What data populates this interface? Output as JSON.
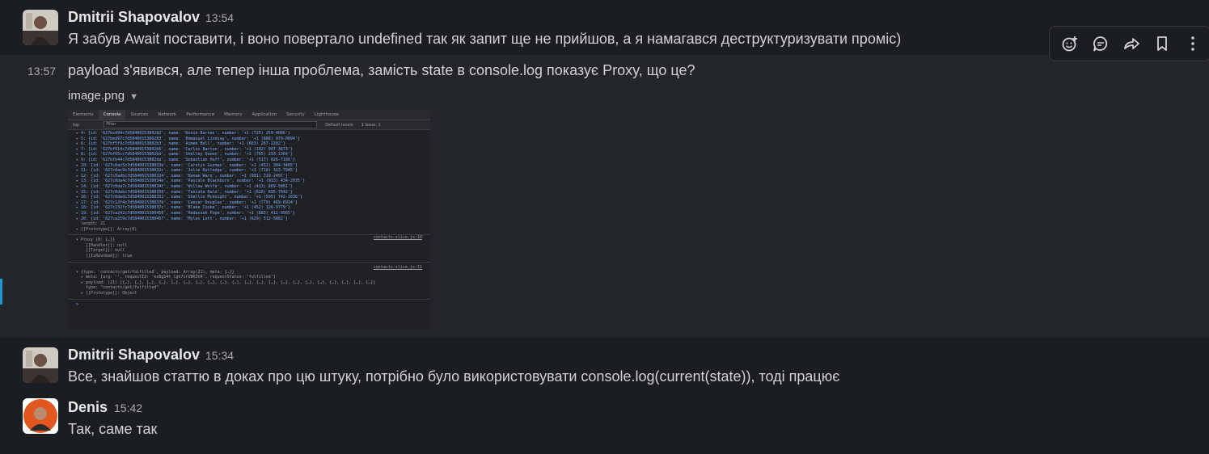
{
  "messages": [
    {
      "author": "Dmitrii Shapovalov",
      "time": "13:54",
      "text": "Я забув Await поставити, і воно повертало undefined так як запит ще не прийшов, а я намагався деструктуризувати проміс)"
    },
    {
      "time": "13:57",
      "text": "payload з'явився, але тепер інша проблема, замість state в console.log показує Proxy, що це?"
    },
    {
      "author": "Dmitrii Shapovalov",
      "time": "15:34",
      "text": "Все, знайшов статтю в доках про цю штуку, потрібно було використовувати console.log(current(state)), тоді працює"
    },
    {
      "author": "Denis",
      "time": "15:42",
      "text": "Так, саме так"
    }
  ],
  "attachment": {
    "file_name": "image.png",
    "devtools": {
      "tabs": [
        "Elements",
        "Console",
        "Sources",
        "Network",
        "Performance",
        "Memory",
        "Application",
        "Security",
        "Lighthouse"
      ],
      "active_tab": "Console",
      "context": "top",
      "filter_placeholder": "Filter",
      "levels": "Default levels",
      "issues": "1 Issue: 1",
      "rows": [
        "▸ 4: {id: '627bcd94c7d5840015380282', name: 'Kosie Barnes', number: '+1 (725) 259-4066'}",
        "▸ 5: {id: '627bed97c7d5840015380283', name: 'Emmanuel Lindsay', number: '+1 (888) 979-0094'}",
        "▸ 6: {id: '627bf5f9c7d58400153802b3', name: 'Aimee Bell', number: '+1 (663) 267-2202'}",
        "▸ 7: {id: '627bf614c7d58400153802b6', name: 'Carlos Barton', number: '+1 (192) 907-3673'}",
        "▸ 8: {id: '627bf65cc7d58400153802bd', name: 'Shelley Queen', number: '+1 (765) 293-1364'}",
        "▸ 9: {id: '627bfb44c7d58400153802de', name: 'Sebastian Huff', number: '+1 (517) 826-7196'}",
        "▸ 10: {id: '627c0ac5c7d584001538033e', name: 'Carolyn Guzman', number: '+1 (452) 304-3465'}",
        "▸ 11: {id: '627c0ac9c7d584001538032c', name: 'Jolie Rutledge', number: '+1 (718) 313-7945'}",
        "▸ 12: {id: '627c0adbc7d5840015380324', name: 'Hanae Ware', number: '+1 (991) 319-2497'}",
        "▸ 13: {id: '627c0da4c7d584001538034e', name: 'Pascale Blackburn', number: '+1 (913) 434-2035'}",
        "▸ 14: {id: '627c0da7c7d584001538034f', name: 'Willow Wolfe', number: '+1 (413) 869-5861'}",
        "▸ 15: {id: '627c0dabc7d5840015380350', name: 'Tanisha Hale', number: '+1 (628) 895-7642'}",
        "▸ 16: {id: '627c0dedc7d5840015380351', name: 'Shellie Mcknight', number: '+1 (595) 742-1036'}",
        "▸ 17: {id: '627c12f4c7d584001538037b', name: 'Caesar Douglas', number: '+1 (779) 469-6914'}",
        "▸ 18: {id: '627c132fc7d584001538037c', name: 'Blake Cooke', number: '+1 (452) 126-9779'}",
        "▸ 19: {id: '627ca242c7d5840015380456', name: 'Hadassah Pope', number: '+1 (883) 411-9565'}",
        "▸ 20: {id: '627ca259c7d5840015380457', name: 'Myles Lott', number: '+1 (629) 512-5882'}",
        "  length: 21",
        "▸ [[Prototype]]: Array(0)"
      ],
      "proxy_link": "contacts-slice.js:10",
      "proxy_rows": [
        "▾ Proxy {0: {…}}",
        "    [[Handler]]: null",
        "    [[Target]]: null",
        "    [[IsRevoked]]: true"
      ],
      "action_link": "contacts-slice.js:11",
      "action_rows": [
        "▾ {type: 'contacts/get/fulfilled', payload: Array(21), meta: {…}}",
        "  ▸ meta: {arg: '', requestId: 'ezBgS4t_lgh7irUBK3VA', requestStatus: 'fulfilled'}",
        "  ▸ payload: (21) [{…}, {…}, {…}, {…}, {…}, {…}, {…}, {…}, {…}, {…}, {…}, {…}, {…}, {…}, {…}, {…}, {…}, {…}, {…}, {…}, {…}]",
        "    type: \"contacts/get/fulfilled\"",
        "  ▸ [[Prototype]]: Object"
      ],
      "prompt": ">"
    }
  },
  "toolbar": [
    "add-reaction-icon",
    "reply-in-thread-icon",
    "share-icon",
    "bookmark-icon",
    "more-icon"
  ]
}
